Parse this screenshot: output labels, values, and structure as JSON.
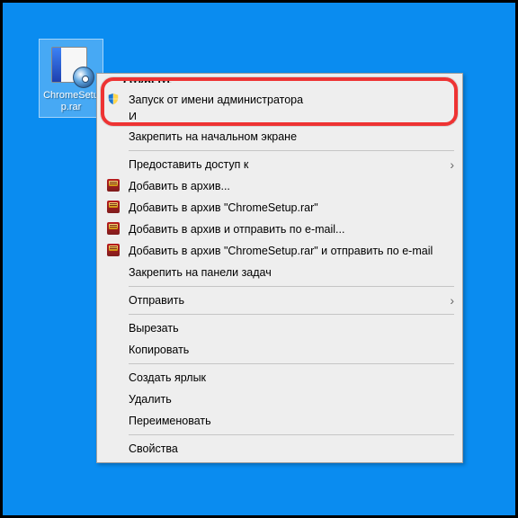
{
  "desktop": {
    "icons": [
      {
        "label": "ChromeSetup.rar"
      }
    ]
  },
  "ctx": {
    "open_peek": "Открыть",
    "run_admin": "Запуск от имени администратора",
    "troubleshoot_peek": "И",
    "pin_start": "Закрепить на начальном экране",
    "share_access": "Предоставить доступ к",
    "add_archive": "Добавить в архив...",
    "add_chromesetup": "Добавить в архив \"ChromeSetup.rar\"",
    "add_send_email": "Добавить в архив и отправить по e-mail...",
    "add_chromesetup_email": "Добавить в архив \"ChromeSetup.rar\" и отправить по e-mail",
    "pin_taskbar": "Закрепить на панели задач",
    "send_to": "Отправить",
    "cut": "Вырезать",
    "copy": "Копировать",
    "shortcut": "Создать ярлык",
    "delete": "Удалить",
    "rename": "Переименовать",
    "properties": "Свойства"
  }
}
